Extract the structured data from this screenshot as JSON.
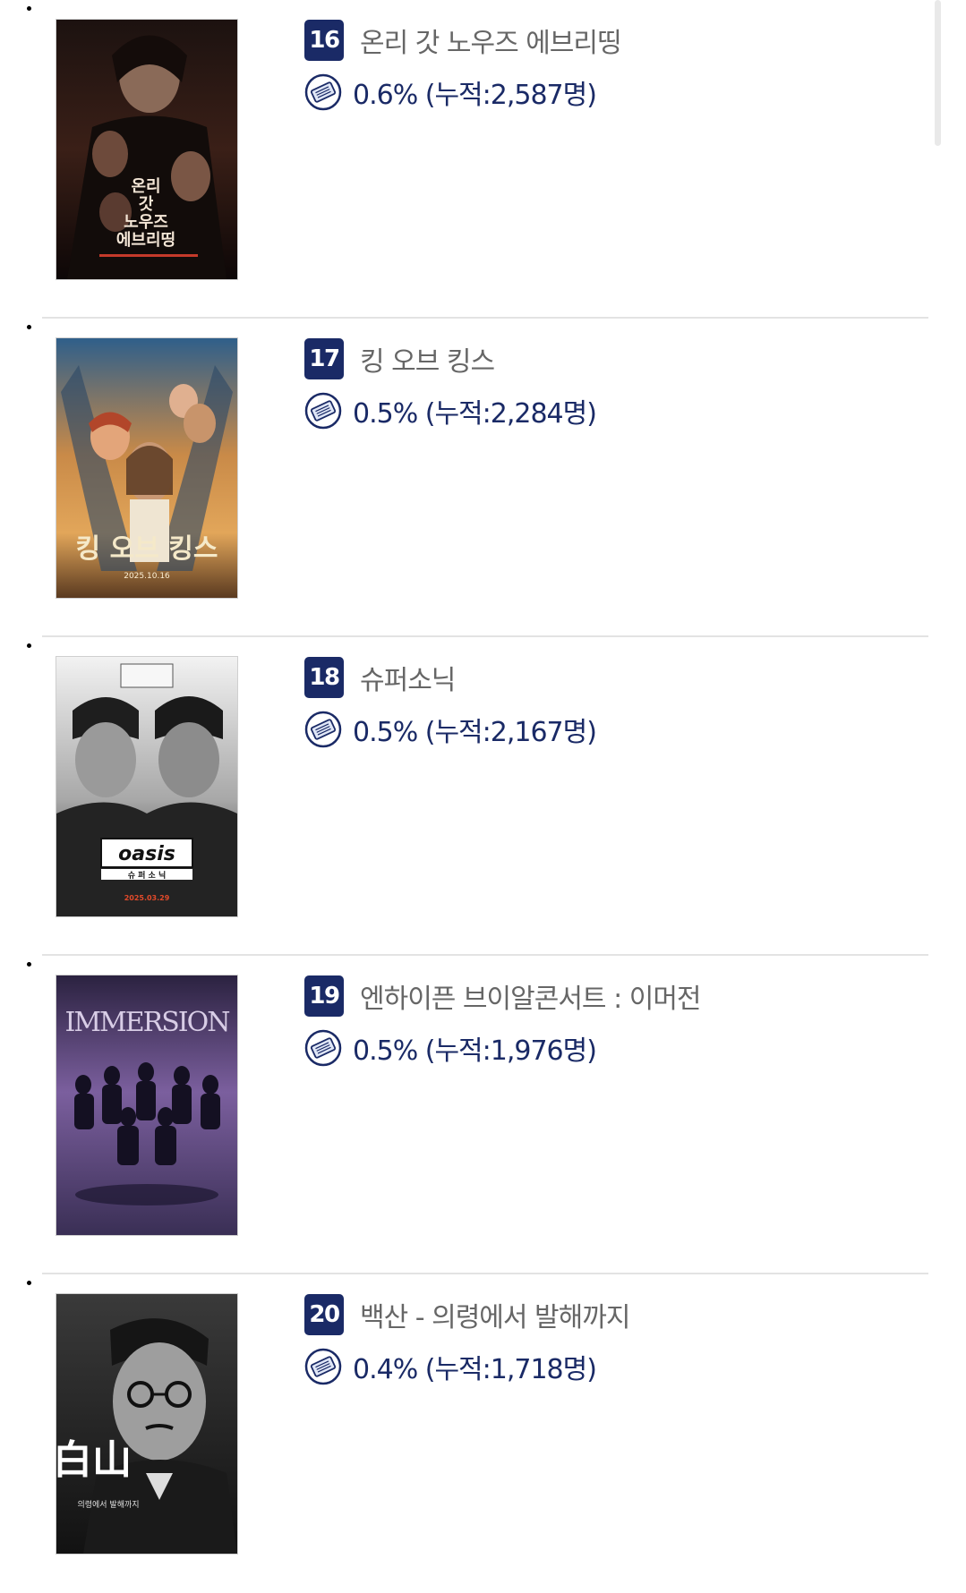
{
  "colors": {
    "rank_badge_bg": "#1a2a66",
    "title_text": "#666666",
    "share_text": "#1a2a66",
    "divider": "#e3e3e3"
  },
  "movies": [
    {
      "rank": "16",
      "title": "온리 갓 노우즈 에브리띵",
      "share": "0.6% (누적:2,587명)",
      "poster_text": [
        "온리",
        "갓",
        "노우즈",
        "에브리띵"
      ],
      "icon": "ticket-icon"
    },
    {
      "rank": "17",
      "title": "킹 오브 킹스",
      "share": "0.5% (누적:2,284명)",
      "poster_text": [
        "킹 오브 킹스",
        "2025.10.16"
      ],
      "icon": "ticket-icon"
    },
    {
      "rank": "18",
      "title": "슈퍼소닉",
      "share": "0.5% (누적:2,167명)",
      "poster_text": [
        "oasis",
        "슈 퍼 소 닉",
        "2025.03.29"
      ],
      "icon": "ticket-icon"
    },
    {
      "rank": "19",
      "title": "엔하이픈 브이알콘서트 : 이머전",
      "share": "0.5% (누적:1,976명)",
      "poster_text": [
        "IMMERSION"
      ],
      "icon": "ticket-icon"
    },
    {
      "rank": "20",
      "title": "백산 - 의령에서 발해까지",
      "share": "0.4% (누적:1,718명)",
      "poster_text": [
        "白山",
        "의령에서 발해까지"
      ],
      "icon": "ticket-icon"
    }
  ]
}
